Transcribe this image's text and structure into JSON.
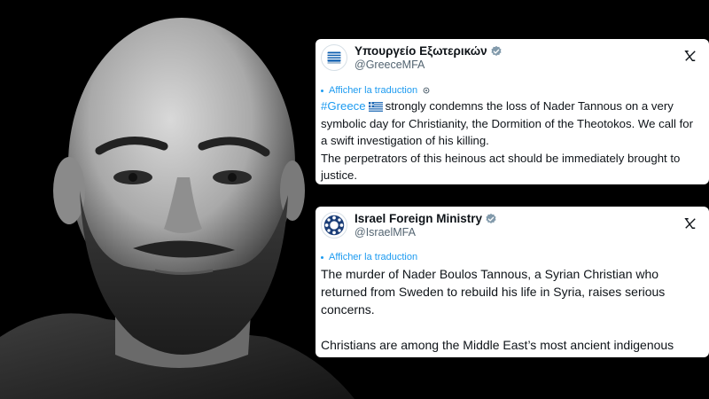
{
  "tweets": [
    {
      "display_name": "Υπουργείο Εξωτερικών",
      "handle": "@GreeceMFA",
      "translate_label": "Afficher la traduction",
      "hashtag": "#Greece",
      "flag_icon": "greece-flag-icon",
      "line1": "strongly condemns the loss of Nader Tannous on a very symbolic day for Christianity, the Dormition of the Theotokos. We call for a swift investigation of his killing.",
      "line2": "The perpetrators of this heinous act should be immediately brought to justice."
    },
    {
      "display_name": "Israel Foreign Ministry",
      "handle": "@IsraelMFA",
      "translate_label": "Afficher la traduction",
      "para1": "The murder of Nader Boulos Tannous, a Syrian Christian who returned from Sweden to rebuild his life in Syria, raises serious concerns.",
      "para2": "Christians are among the Middle East’s most ancient indigenous communities. Their security must be guaranteed."
    }
  ],
  "colors": {
    "link": "#1d9bf0",
    "verified": "#829aab",
    "text": "#0f1419",
    "muted": "#536471"
  }
}
